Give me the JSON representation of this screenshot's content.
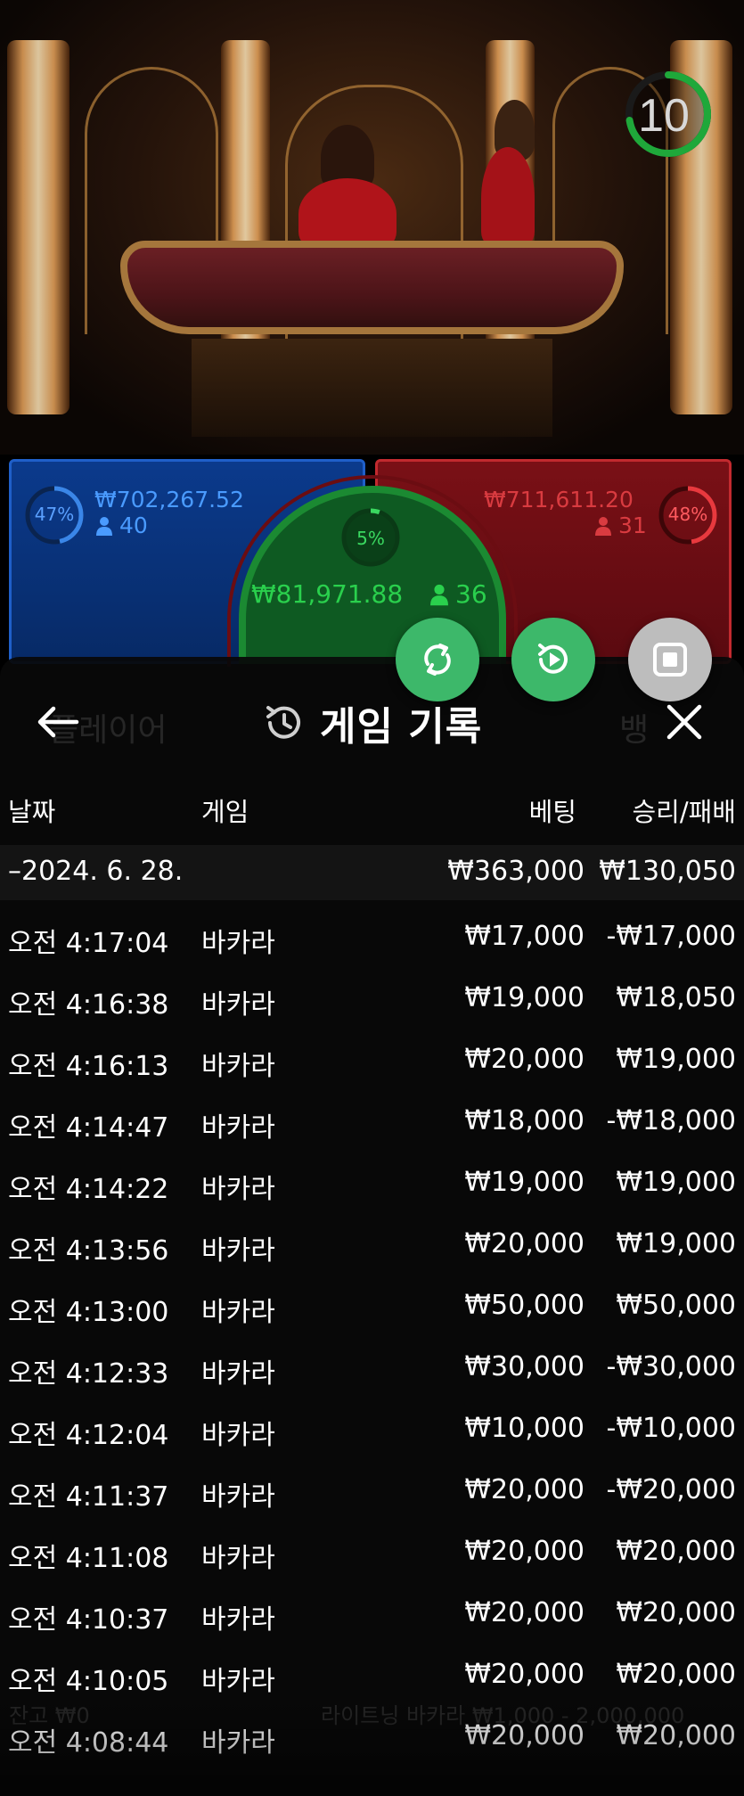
{
  "video": {
    "timer_value": "10",
    "timer_color": "#1fa83a"
  },
  "bets": {
    "player": {
      "percent": "47%",
      "amount": "₩702,267.52",
      "players": "40",
      "color": "#1f5fc9"
    },
    "banker": {
      "percent": "48%",
      "amount": "₩711,611.20",
      "players": "31",
      "color": "#c22a2f"
    },
    "tie": {
      "percent": "5%",
      "amount": "₩81,971.88",
      "players": "36",
      "color": "#1b8a32"
    }
  },
  "actions": {
    "button1_icon": "rotate-arrows-icon",
    "button2_icon": "replay-icon",
    "button3_icon": "stop-icon",
    "accent": "#3db86a"
  },
  "panel": {
    "title": "게임 기록",
    "title_icon": "history-icon",
    "back_icon": "arrow-left-icon",
    "close_icon": "close-icon",
    "columns": {
      "date": "날짜",
      "game": "게임",
      "bet": "베팅",
      "win_loss": "승리/패배"
    },
    "date_group": {
      "date": "–2024. 6. 28.",
      "bet": "₩363,000",
      "win_loss": "₩130,050"
    },
    "rows": [
      {
        "time": "오전 4:17:04",
        "game": "바카라",
        "bet": "₩17,000",
        "win_loss": "-₩17,000"
      },
      {
        "time": "오전 4:16:38",
        "game": "바카라",
        "bet": "₩19,000",
        "win_loss": "₩18,050"
      },
      {
        "time": "오전 4:16:13",
        "game": "바카라",
        "bet": "₩20,000",
        "win_loss": "₩19,000"
      },
      {
        "time": "오전 4:14:47",
        "game": "바카라",
        "bet": "₩18,000",
        "win_loss": "-₩18,000"
      },
      {
        "time": "오전 4:14:22",
        "game": "바카라",
        "bet": "₩19,000",
        "win_loss": "₩19,000"
      },
      {
        "time": "오전 4:13:56",
        "game": "바카라",
        "bet": "₩20,000",
        "win_loss": "₩19,000"
      },
      {
        "time": "오전 4:13:00",
        "game": "바카라",
        "bet": "₩50,000",
        "win_loss": "₩50,000"
      },
      {
        "time": "오전 4:12:33",
        "game": "바카라",
        "bet": "₩30,000",
        "win_loss": "-₩30,000"
      },
      {
        "time": "오전 4:12:04",
        "game": "바카라",
        "bet": "₩10,000",
        "win_loss": "-₩10,000"
      },
      {
        "time": "오전 4:11:37",
        "game": "바카라",
        "bet": "₩20,000",
        "win_loss": "-₩20,000"
      },
      {
        "time": "오전 4:11:08",
        "game": "바카라",
        "bet": "₩20,000",
        "win_loss": "₩20,000"
      },
      {
        "time": "오전 4:10:37",
        "game": "바카라",
        "bet": "₩20,000",
        "win_loss": "₩20,000"
      },
      {
        "time": "오전 4:10:05",
        "game": "바카라",
        "bet": "₩20,000",
        "win_loss": "₩20,000"
      },
      {
        "time": "오전 4:08:44",
        "game": "바카라",
        "bet": "₩20,000",
        "win_loss": "₩20,000"
      }
    ]
  },
  "background_hints": {
    "player_label": "플레이어",
    "banker_label": "뱅",
    "footer_left": "잔고 ₩0",
    "footer_right": "라이트닝 바카라 ₩1,000 - 2,000,000"
  }
}
